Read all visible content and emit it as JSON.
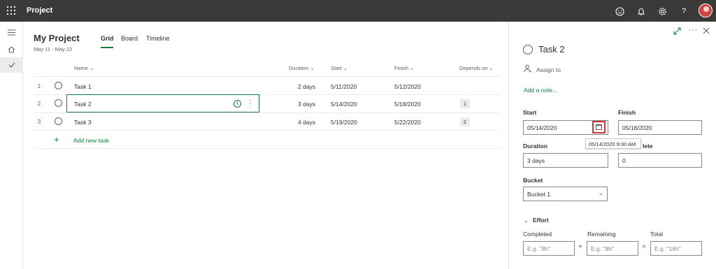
{
  "app": {
    "title": "Project"
  },
  "header_icons": {
    "smile": "☺",
    "bell": "🔔",
    "gear": "⚙",
    "help": "?"
  },
  "project": {
    "title": "My Project",
    "dates": "May 11 - May 22"
  },
  "tabs": [
    {
      "label": "Grid"
    },
    {
      "label": "Board"
    },
    {
      "label": "Timeline"
    }
  ],
  "columns": {
    "name": "Name",
    "duration": "Duration",
    "start": "Start",
    "finish": "Finish",
    "depends": "Depends on"
  },
  "tasks": [
    {
      "num": "1",
      "name": "Task 1",
      "duration": "2 days",
      "start": "5/11/2020",
      "finish": "5/12/2020",
      "depends": ""
    },
    {
      "num": "2",
      "name": "Task 2",
      "duration": "3 days",
      "start": "5/14/2020",
      "finish": "5/18/2020",
      "depends": "1"
    },
    {
      "num": "3",
      "name": "Task 3",
      "duration": "4 days",
      "start": "5/19/2020",
      "finish": "5/22/2020",
      "depends": "2"
    }
  ],
  "add_task_label": "Add new task",
  "panel": {
    "task_name": "Task 2",
    "assign_label": "Assign to",
    "note_label": "Add a note...",
    "start_label": "Start",
    "start_value": "05/14/2020",
    "finish_label": "Finish",
    "finish_value": "05/18/2020",
    "tooltip": "05/14/2020 9:00 AM",
    "duration_label": "Duration",
    "duration_value": "3 days",
    "complete_label_visible": "lete",
    "complete_value": "0",
    "bucket_label": "Bucket",
    "bucket_value": "Bucket 1",
    "effort_label": "Effort",
    "completed_label": "Completed",
    "remaining_label": "Remaining",
    "total_label": "Total",
    "completed_placeholder": "E.g. \"8h\"",
    "remaining_placeholder": "E.g. \"8h\"",
    "total_placeholder": "E.g. \"16h\"",
    "plus_op": "+",
    "equals_op": "="
  },
  "colors": {
    "accent": "#107c41",
    "topbar": "#3b3a39",
    "highlight": "#d13438"
  }
}
